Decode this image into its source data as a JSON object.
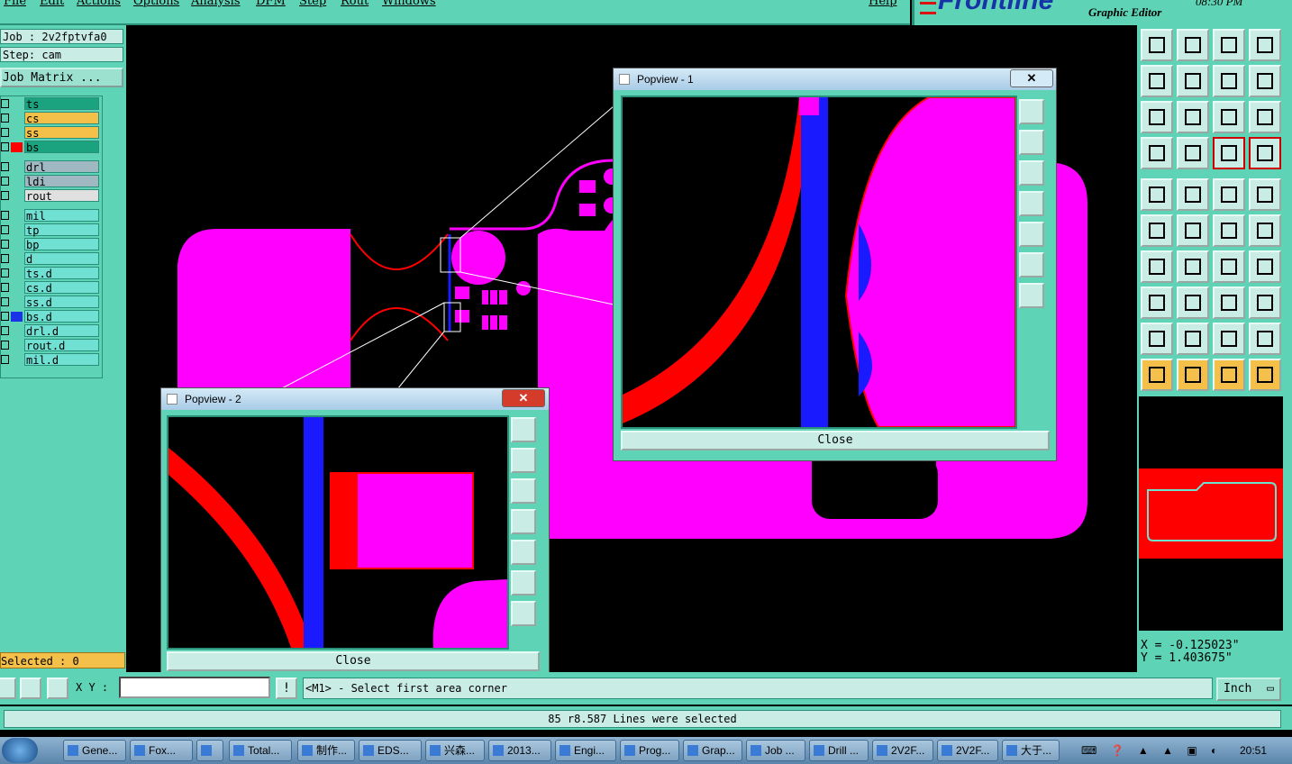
{
  "menubar": {
    "items": [
      "File",
      "Edit",
      "Actions",
      "Options",
      "Analysis",
      "DFM",
      "Step",
      "Rout",
      "Windows"
    ],
    "help": "Help"
  },
  "logo": {
    "brand": "Frontline",
    "subtitle": "Graphic Editor",
    "time": "08:30 PM"
  },
  "job": {
    "name": "Job : 2v2fptvfa0",
    "step": "Step: cam",
    "matrix_button": "Job Matrix ..."
  },
  "layers": [
    {
      "name": "ts",
      "color": "#1aa37e",
      "swatch": ""
    },
    {
      "name": "cs",
      "color": "#f5c04a",
      "swatch": ""
    },
    {
      "name": "ss",
      "color": "#f5c04a",
      "swatch": ""
    },
    {
      "name": "bs",
      "color": "#1aa37e",
      "swatch": "#ff0000"
    },
    {
      "name": "drl",
      "color": "#9fb8c2",
      "swatch": ""
    },
    {
      "name": "ldi",
      "color": "#9fb8c2",
      "swatch": ""
    },
    {
      "name": "rout",
      "color": "#e0e0e0",
      "swatch": ""
    },
    {
      "name": "mil",
      "color": "#6fe0d2",
      "swatch": ""
    },
    {
      "name": "tp",
      "color": "#6fe0d2",
      "swatch": ""
    },
    {
      "name": "bp",
      "color": "#6fe0d2",
      "swatch": ""
    },
    {
      "name": "d",
      "color": "#6fe0d2",
      "swatch": ""
    },
    {
      "name": "ts.d",
      "color": "#6fe0d2",
      "swatch": ""
    },
    {
      "name": "cs.d",
      "color": "#6fe0d2",
      "swatch": ""
    },
    {
      "name": "ss.d",
      "color": "#6fe0d2",
      "swatch": ""
    },
    {
      "name": "bs.d",
      "color": "#6fe0d2",
      "swatch": "#1a33e6"
    },
    {
      "name": "drl.d",
      "color": "#6fe0d2",
      "swatch": ""
    },
    {
      "name": "rout.d",
      "color": "#6fe0d2",
      "swatch": ""
    },
    {
      "name": "mil.d",
      "color": "#6fe0d2",
      "swatch": ""
    }
  ],
  "selected": "Selected : 0",
  "popview1": {
    "title": "Popview - 1",
    "close": "Close"
  },
  "popview2": {
    "title": "Popview - 2",
    "close": "Close"
  },
  "coords": {
    "x": "X = -0.125023\"",
    "y": "Y = 1.403675\""
  },
  "cmd": {
    "xy_label": "X Y :",
    "xy_value": "",
    "prompt": "<M1> - Select first area corner",
    "unit": "Inch"
  },
  "message": "85 r8.587 Lines were selected",
  "taskbar": {
    "items": [
      "Gene...",
      "Fox...",
      "",
      "Total...",
      "制作...",
      "EDS...",
      "兴森...",
      "2013...",
      "Engi...",
      "Prog...",
      "Grap...",
      "Job ...",
      "Drill ...",
      "2V2F...",
      "2V2F...",
      "大于..."
    ],
    "clock": "20:51"
  },
  "colors": {
    "copper": "#ff00ff",
    "outline": "#ff0000",
    "blue": "#1a1aff",
    "panel": "#5ed3b5"
  }
}
